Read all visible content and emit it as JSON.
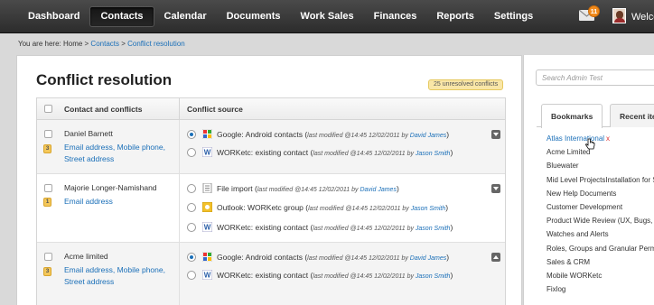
{
  "nav": {
    "items": [
      "Dashboard",
      "Contacts",
      "Calendar",
      "Documents",
      "Work Sales",
      "Finances",
      "Reports",
      "Settings"
    ],
    "active_index": 1,
    "mail_badge": "11",
    "welcome": "Welcome"
  },
  "breadcrumb": {
    "prefix": "You are here: Home > ",
    "contacts": "Contacts",
    "sep": " > ",
    "current": "Conflict resolution"
  },
  "page": {
    "title": "Conflict resolution",
    "unresolved": "25 unresolved conflicts"
  },
  "table": {
    "col_contact": "Contact and conflicts",
    "col_source": "Conflict source",
    "rows": [
      {
        "name": "Daniel Barnett",
        "count": "3",
        "links_line1": "Email address, Mobile phone,",
        "links_line2": "Street address",
        "sources": [
          {
            "icon": "google-icon",
            "label": "Google: Android contacts (",
            "meta": "last modified @14:45 12/02/2011 by ",
            "user": "David James",
            "close": ")",
            "selected": true
          },
          {
            "icon": "worketc-icon",
            "label": "WORKetc: existing contact (",
            "meta": "last modified @14:45 12/02/2011 by ",
            "user": "Jason Smith",
            "close": ")",
            "selected": false
          }
        ]
      },
      {
        "name": "Majorie Longer-Namishand",
        "count": "1",
        "links_line1": "Email address",
        "links_line2": "",
        "sources": [
          {
            "icon": "file-icon",
            "label": "File import (",
            "meta": "last modified @14:45 12/02/2011 by ",
            "user": "David James",
            "close": ")",
            "selected": false
          },
          {
            "icon": "outlook-icon",
            "label": "Outlook: WORKetc group (",
            "meta": "last modified @14:45 12/02/2011 by ",
            "user": "Jason Smith",
            "close": ")",
            "selected": false
          },
          {
            "icon": "worketc-icon",
            "label": "WORKetc: existing contact (",
            "meta": "last modified @14:45 12/02/2011 by ",
            "user": "Jason Smith",
            "close": ")",
            "selected": false
          }
        ]
      },
      {
        "name": "Acme limited",
        "count": "3",
        "links_line1": "Email address, Mobile phone,",
        "links_line2": "Street address",
        "sources": [
          {
            "icon": "google-icon",
            "label": "Google: Android contacts (",
            "meta": "last modified @14:45 12/02/2011 by ",
            "user": "David James",
            "close": ")",
            "selected": true
          },
          {
            "icon": "worketc-icon",
            "label": "WORKetc: existing contact (",
            "meta": "last modified @14:45 12/02/2011 by ",
            "user": "Jason Smith",
            "close": ")",
            "selected": false
          }
        ]
      }
    ]
  },
  "sidebar": {
    "search_placeholder": "Search Admin Test",
    "tab_bookmarks": "Bookmarks",
    "tab_recent": "Recent ite",
    "bookmarks": [
      "Atlas International",
      "Acme Limited",
      "Bluewater",
      "Mid Level ProjectsInstallation for S",
      "New Help Documents",
      "Customer Development",
      "Product Wide Review (UX, Bugs,",
      "Watches and Alerts",
      "Roles, Groups and Granular Perm",
      "Sales & CRM",
      "Mobile WORKetc",
      "Fixlog"
    ],
    "remove_symbol": "x"
  },
  "colors": {
    "link": "#1a6fb8",
    "badge": "#f4c75a",
    "topbar": "#333333",
    "mail_badge": "#f08a1c"
  }
}
